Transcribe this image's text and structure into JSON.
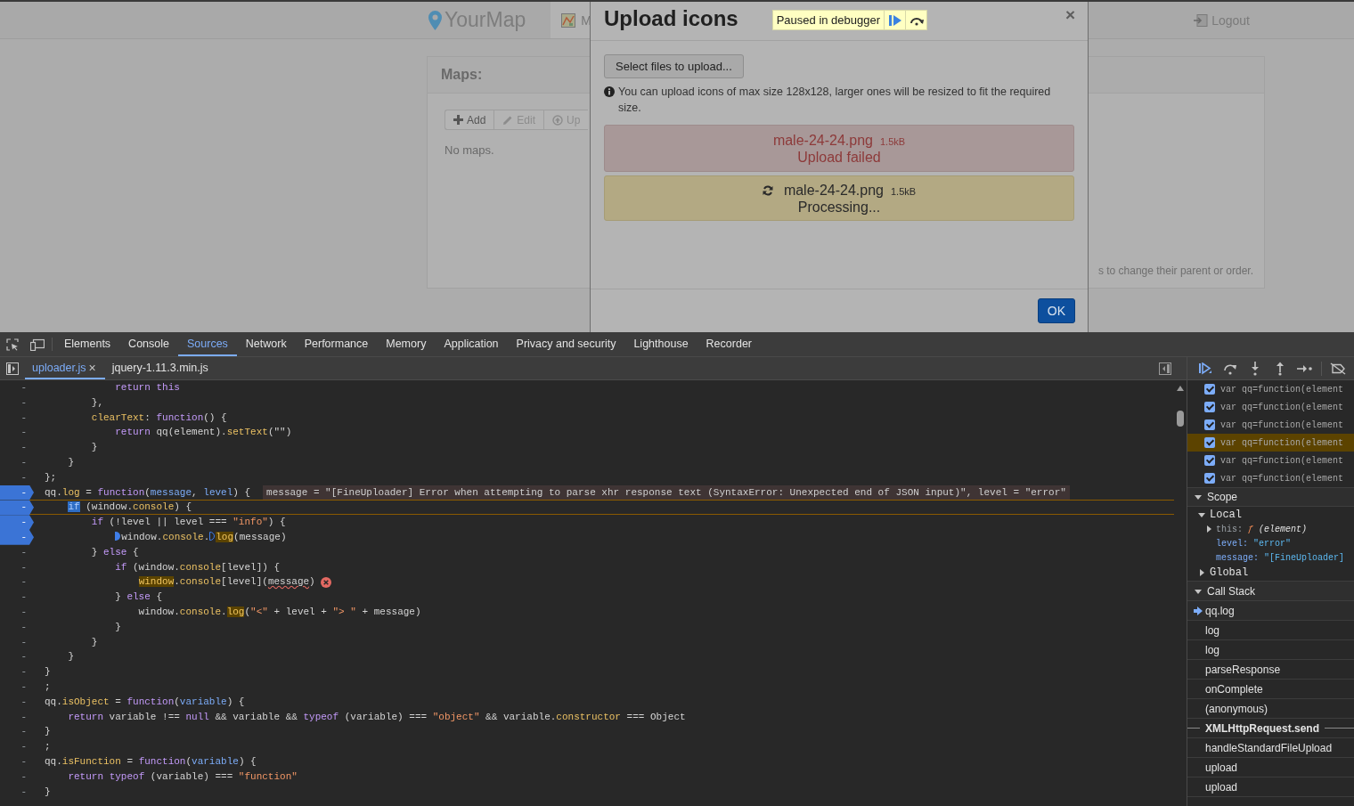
{
  "page": {
    "navbar": {
      "brand": "YourMap",
      "tab_label": "M",
      "logout": "Logout"
    },
    "panel": {
      "title": "Maps:",
      "buttons": [
        {
          "label": "Add",
          "kind": "add",
          "disabled": false
        },
        {
          "label": "Edit",
          "kind": "edit",
          "disabled": true
        },
        {
          "label": "Up",
          "kind": "upload",
          "disabled": true
        }
      ],
      "empty_text": "No maps.",
      "hint": "s to change their parent or order."
    }
  },
  "modal": {
    "title": "Upload icons",
    "close": "×",
    "select_button": "Select files to upload...",
    "info": "You can upload icons of max size 128x128, larger ones will be resized to fit the required size.",
    "files": [
      {
        "name": "male-24-24.png",
        "size": "1.5kB",
        "status": "Upload failed",
        "kind": "failed"
      },
      {
        "name": "male-24-24.png",
        "size": "1.5kB",
        "status": "Processing...",
        "kind": "processing"
      }
    ],
    "ok_button": "OK"
  },
  "debugger_badge": {
    "text": "Paused in debugger"
  },
  "devtools": {
    "tabs": [
      {
        "label": "Elements",
        "selected": false
      },
      {
        "label": "Console",
        "selected": false
      },
      {
        "label": "Sources",
        "selected": true
      },
      {
        "label": "Network",
        "selected": false
      },
      {
        "label": "Performance",
        "selected": false
      },
      {
        "label": "Memory",
        "selected": false
      },
      {
        "label": "Application",
        "selected": false
      },
      {
        "label": "Privacy and security",
        "selected": false
      },
      {
        "label": "Lighthouse",
        "selected": false
      },
      {
        "label": "Recorder",
        "selected": false
      }
    ],
    "file_tabs": [
      {
        "label": "uploader.js",
        "selected": true,
        "close": "×"
      },
      {
        "label": "jquery-1.11.3.min.js",
        "selected": false
      }
    ],
    "code": {
      "lines": [
        {
          "gutter": "-",
          "breakpoint": false,
          "current": false,
          "tokens": [
            {
              "kind": "kw",
              "text": "            return"
            },
            {
              "kind": "kw",
              "text": " this"
            }
          ]
        },
        {
          "gutter": "-",
          "breakpoint": false,
          "current": false,
          "tokens": [
            {
              "kind": "pl",
              "text": "        },"
            }
          ]
        },
        {
          "gutter": "-",
          "breakpoint": false,
          "current": false,
          "tokens": [
            {
              "kind": "prop",
              "text": "        clearText"
            },
            {
              "kind": "pl",
              "text": ": "
            },
            {
              "kind": "kw",
              "text": "function"
            },
            {
              "kind": "pl",
              "text": "() {"
            }
          ]
        },
        {
          "gutter": "-",
          "breakpoint": false,
          "current": false,
          "tokens": [
            {
              "kind": "kw",
              "text": "            return"
            },
            {
              "kind": "pl",
              "text": " qq(element)."
            },
            {
              "kind": "prop",
              "text": "setText"
            },
            {
              "kind": "pl",
              "text": "(\"\")"
            }
          ]
        },
        {
          "gutter": "-",
          "breakpoint": false,
          "current": false,
          "tokens": [
            {
              "kind": "pl",
              "text": "        }"
            }
          ]
        },
        {
          "gutter": "-",
          "breakpoint": false,
          "current": false,
          "tokens": [
            {
              "kind": "pl",
              "text": "    }"
            }
          ]
        },
        {
          "gutter": "-",
          "breakpoint": false,
          "current": false,
          "tokens": [
            {
              "kind": "pl",
              "text": "};"
            }
          ]
        },
        {
          "gutter": "-",
          "breakpoint": true,
          "current": false,
          "tokens": [
            {
              "kind": "pl",
              "text": "qq."
            },
            {
              "kind": "prop",
              "text": "log"
            },
            {
              "kind": "pl",
              "text": " = "
            },
            {
              "kind": "kw",
              "text": "function"
            },
            {
              "kind": "pl",
              "text": "("
            },
            {
              "kind": "param",
              "text": "message"
            },
            {
              "kind": "pl",
              "text": ", "
            },
            {
              "kind": "param",
              "text": "level"
            },
            {
              "kind": "pl",
              "text": ") {"
            }
          ],
          "inline_value": "message = \"[FineUploader] Error when attempting to parse xhr response text (SyntaxError: Unexpected end of JSON input)\", level = \"error\""
        },
        {
          "gutter": "-",
          "breakpoint": true,
          "current": true,
          "tokens": [
            {
              "kind": "exec",
              "text": "    if"
            },
            {
              "kind": "pl",
              "text": " (window."
            },
            {
              "kind": "prop",
              "text": "console"
            },
            {
              "kind": "pl",
              "text": ") {"
            }
          ]
        },
        {
          "gutter": "-",
          "breakpoint": true,
          "current": false,
          "tokens": [
            {
              "kind": "kw",
              "text": "        if"
            },
            {
              "kind": "pl",
              "text": " (!level || level === "
            },
            {
              "kind": "str",
              "text": "\"info\""
            },
            {
              "kind": "pl",
              "text": ") {"
            }
          ]
        },
        {
          "gutter": "-",
          "breakpoint": true,
          "current": false,
          "tokens": [
            {
              "kind": "stop",
              "text": "            window."
            },
            {
              "kind": "prop",
              "text": "console"
            },
            {
              "kind": "pl",
              "text": "."
            },
            {
              "kind": "hl-stop",
              "text": "log"
            },
            {
              "kind": "pl",
              "text": "(message)"
            }
          ]
        },
        {
          "gutter": "-",
          "breakpoint": false,
          "current": false,
          "tokens": [
            {
              "kind": "pl",
              "text": "        } "
            },
            {
              "kind": "kw",
              "text": "else"
            },
            {
              "kind": "pl",
              "text": " {"
            }
          ]
        },
        {
          "gutter": "-",
          "breakpoint": false,
          "current": false,
          "tokens": [
            {
              "kind": "kw",
              "text": "            if"
            },
            {
              "kind": "pl",
              "text": " (window."
            },
            {
              "kind": "prop",
              "text": "console"
            },
            {
              "kind": "pl",
              "text": "[level]) {"
            }
          ]
        },
        {
          "gutter": "-",
          "breakpoint": false,
          "current": false,
          "error": true,
          "tokens": [
            {
              "kind": "hl",
              "text": "                window"
            },
            {
              "kind": "pl",
              "text": "."
            },
            {
              "kind": "prop",
              "text": "console"
            },
            {
              "kind": "pl",
              "text": "[level]("
            },
            {
              "kind": "err",
              "text": "message"
            },
            {
              "kind": "pl",
              "text": ")"
            }
          ]
        },
        {
          "gutter": "-",
          "breakpoint": false,
          "current": false,
          "tokens": [
            {
              "kind": "pl",
              "text": "            } "
            },
            {
              "kind": "kw",
              "text": "else"
            },
            {
              "kind": "pl",
              "text": " {"
            }
          ]
        },
        {
          "gutter": "-",
          "breakpoint": false,
          "current": false,
          "tokens": [
            {
              "kind": "pl",
              "text": "                window."
            },
            {
              "kind": "prop",
              "text": "console"
            },
            {
              "kind": "pl",
              "text": "."
            },
            {
              "kind": "hl",
              "text": "log"
            },
            {
              "kind": "pl",
              "text": "("
            },
            {
              "kind": "str",
              "text": "\"<\""
            },
            {
              "kind": "pl",
              "text": " + level + "
            },
            {
              "kind": "str",
              "text": "\"> \""
            },
            {
              "kind": "pl",
              "text": " + message)"
            }
          ]
        },
        {
          "gutter": "-",
          "breakpoint": false,
          "current": false,
          "tokens": [
            {
              "kind": "pl",
              "text": "            }"
            }
          ]
        },
        {
          "gutter": "-",
          "breakpoint": false,
          "current": false,
          "tokens": [
            {
              "kind": "pl",
              "text": "        }"
            }
          ]
        },
        {
          "gutter": "-",
          "breakpoint": false,
          "current": false,
          "tokens": [
            {
              "kind": "pl",
              "text": "    }"
            }
          ]
        },
        {
          "gutter": "-",
          "breakpoint": false,
          "current": false,
          "tokens": [
            {
              "kind": "pl",
              "text": "}"
            }
          ]
        },
        {
          "gutter": "-",
          "breakpoint": false,
          "current": false,
          "tokens": [
            {
              "kind": "pl",
              "text": ";"
            }
          ]
        },
        {
          "gutter": "-",
          "breakpoint": false,
          "current": false,
          "tokens": [
            {
              "kind": "pl",
              "text": "qq."
            },
            {
              "kind": "prop",
              "text": "isObject"
            },
            {
              "kind": "pl",
              "text": " = "
            },
            {
              "kind": "kw",
              "text": "function"
            },
            {
              "kind": "pl",
              "text": "("
            },
            {
              "kind": "param",
              "text": "variable"
            },
            {
              "kind": "pl",
              "text": ") {"
            }
          ]
        },
        {
          "gutter": "-",
          "breakpoint": false,
          "current": false,
          "tokens": [
            {
              "kind": "kw",
              "text": "    return"
            },
            {
              "kind": "pl",
              "text": " variable !== "
            },
            {
              "kind": "kw",
              "text": "null"
            },
            {
              "kind": "pl",
              "text": " && variable && "
            },
            {
              "kind": "kw",
              "text": "typeof"
            },
            {
              "kind": "pl",
              "text": " (variable) === "
            },
            {
              "kind": "str",
              "text": "\"object\""
            },
            {
              "kind": "pl",
              "text": " && variable."
            },
            {
              "kind": "prop",
              "text": "constructor"
            },
            {
              "kind": "pl",
              "text": " === Object"
            }
          ]
        },
        {
          "gutter": "-",
          "breakpoint": false,
          "current": false,
          "tokens": [
            {
              "kind": "pl",
              "text": "}"
            }
          ]
        },
        {
          "gutter": "-",
          "breakpoint": false,
          "current": false,
          "tokens": [
            {
              "kind": "pl",
              "text": ";"
            }
          ]
        },
        {
          "gutter": "-",
          "breakpoint": false,
          "current": false,
          "tokens": [
            {
              "kind": "pl",
              "text": "qq."
            },
            {
              "kind": "prop",
              "text": "isFunction"
            },
            {
              "kind": "pl",
              "text": " = "
            },
            {
              "kind": "kw",
              "text": "function"
            },
            {
              "kind": "pl",
              "text": "("
            },
            {
              "kind": "param",
              "text": "variable"
            },
            {
              "kind": "pl",
              "text": ") {"
            }
          ]
        },
        {
          "gutter": "-",
          "breakpoint": false,
          "current": false,
          "tokens": [
            {
              "kind": "kw",
              "text": "    return"
            },
            {
              "kind": "kw",
              "text": " typeof"
            },
            {
              "kind": "pl",
              "text": " (variable) === "
            },
            {
              "kind": "str",
              "text": "\"function\""
            }
          ]
        },
        {
          "gutter": "-",
          "breakpoint": false,
          "current": false,
          "tokens": [
            {
              "kind": "pl",
              "text": "}"
            }
          ]
        }
      ]
    },
    "sidebar": {
      "breakpoints": [
        {
          "code": "var qq=function(element",
          "checked": true,
          "selected": false
        },
        {
          "code": "var qq=function(element",
          "checked": true,
          "selected": false
        },
        {
          "code": "var qq=function(element",
          "checked": true,
          "selected": false
        },
        {
          "code": "var qq=function(element",
          "checked": true,
          "selected": true
        },
        {
          "code": "var qq=function(element",
          "checked": true,
          "selected": false
        },
        {
          "code": "var qq=function(element",
          "checked": true,
          "selected": false
        }
      ],
      "scope": {
        "title": "Scope",
        "expanded": true,
        "groups": [
          {
            "name": "Local",
            "expanded": true,
            "vars": [
              {
                "name": "this:",
                "kind": "function",
                "prefix": "ƒ",
                "value": "(element)"
              },
              {
                "name": "level:",
                "kind": "string",
                "value": "\"error\""
              },
              {
                "name": "message:",
                "kind": "string",
                "value": "\"[FineUploader]"
              }
            ]
          },
          {
            "name": "Global",
            "expanded": false
          }
        ]
      },
      "call_stack": {
        "title": "Call Stack",
        "expanded": true,
        "frames": [
          {
            "name": "qq.log",
            "kind": "frame",
            "current": true
          },
          {
            "name": "log",
            "kind": "frame",
            "current": false
          },
          {
            "name": "log",
            "kind": "frame",
            "current": false
          },
          {
            "name": "parseResponse",
            "kind": "frame",
            "current": false
          },
          {
            "name": "onComplete",
            "kind": "frame",
            "current": false
          },
          {
            "name": "(anonymous)",
            "kind": "frame",
            "current": false
          },
          {
            "name": "XMLHttpRequest.send",
            "kind": "async",
            "current": false
          },
          {
            "name": "handleStandardFileUpload",
            "kind": "frame",
            "current": false
          },
          {
            "name": "upload",
            "kind": "frame",
            "current": false
          },
          {
            "name": "upload",
            "kind": "frame",
            "current": false
          }
        ]
      }
    }
  }
}
